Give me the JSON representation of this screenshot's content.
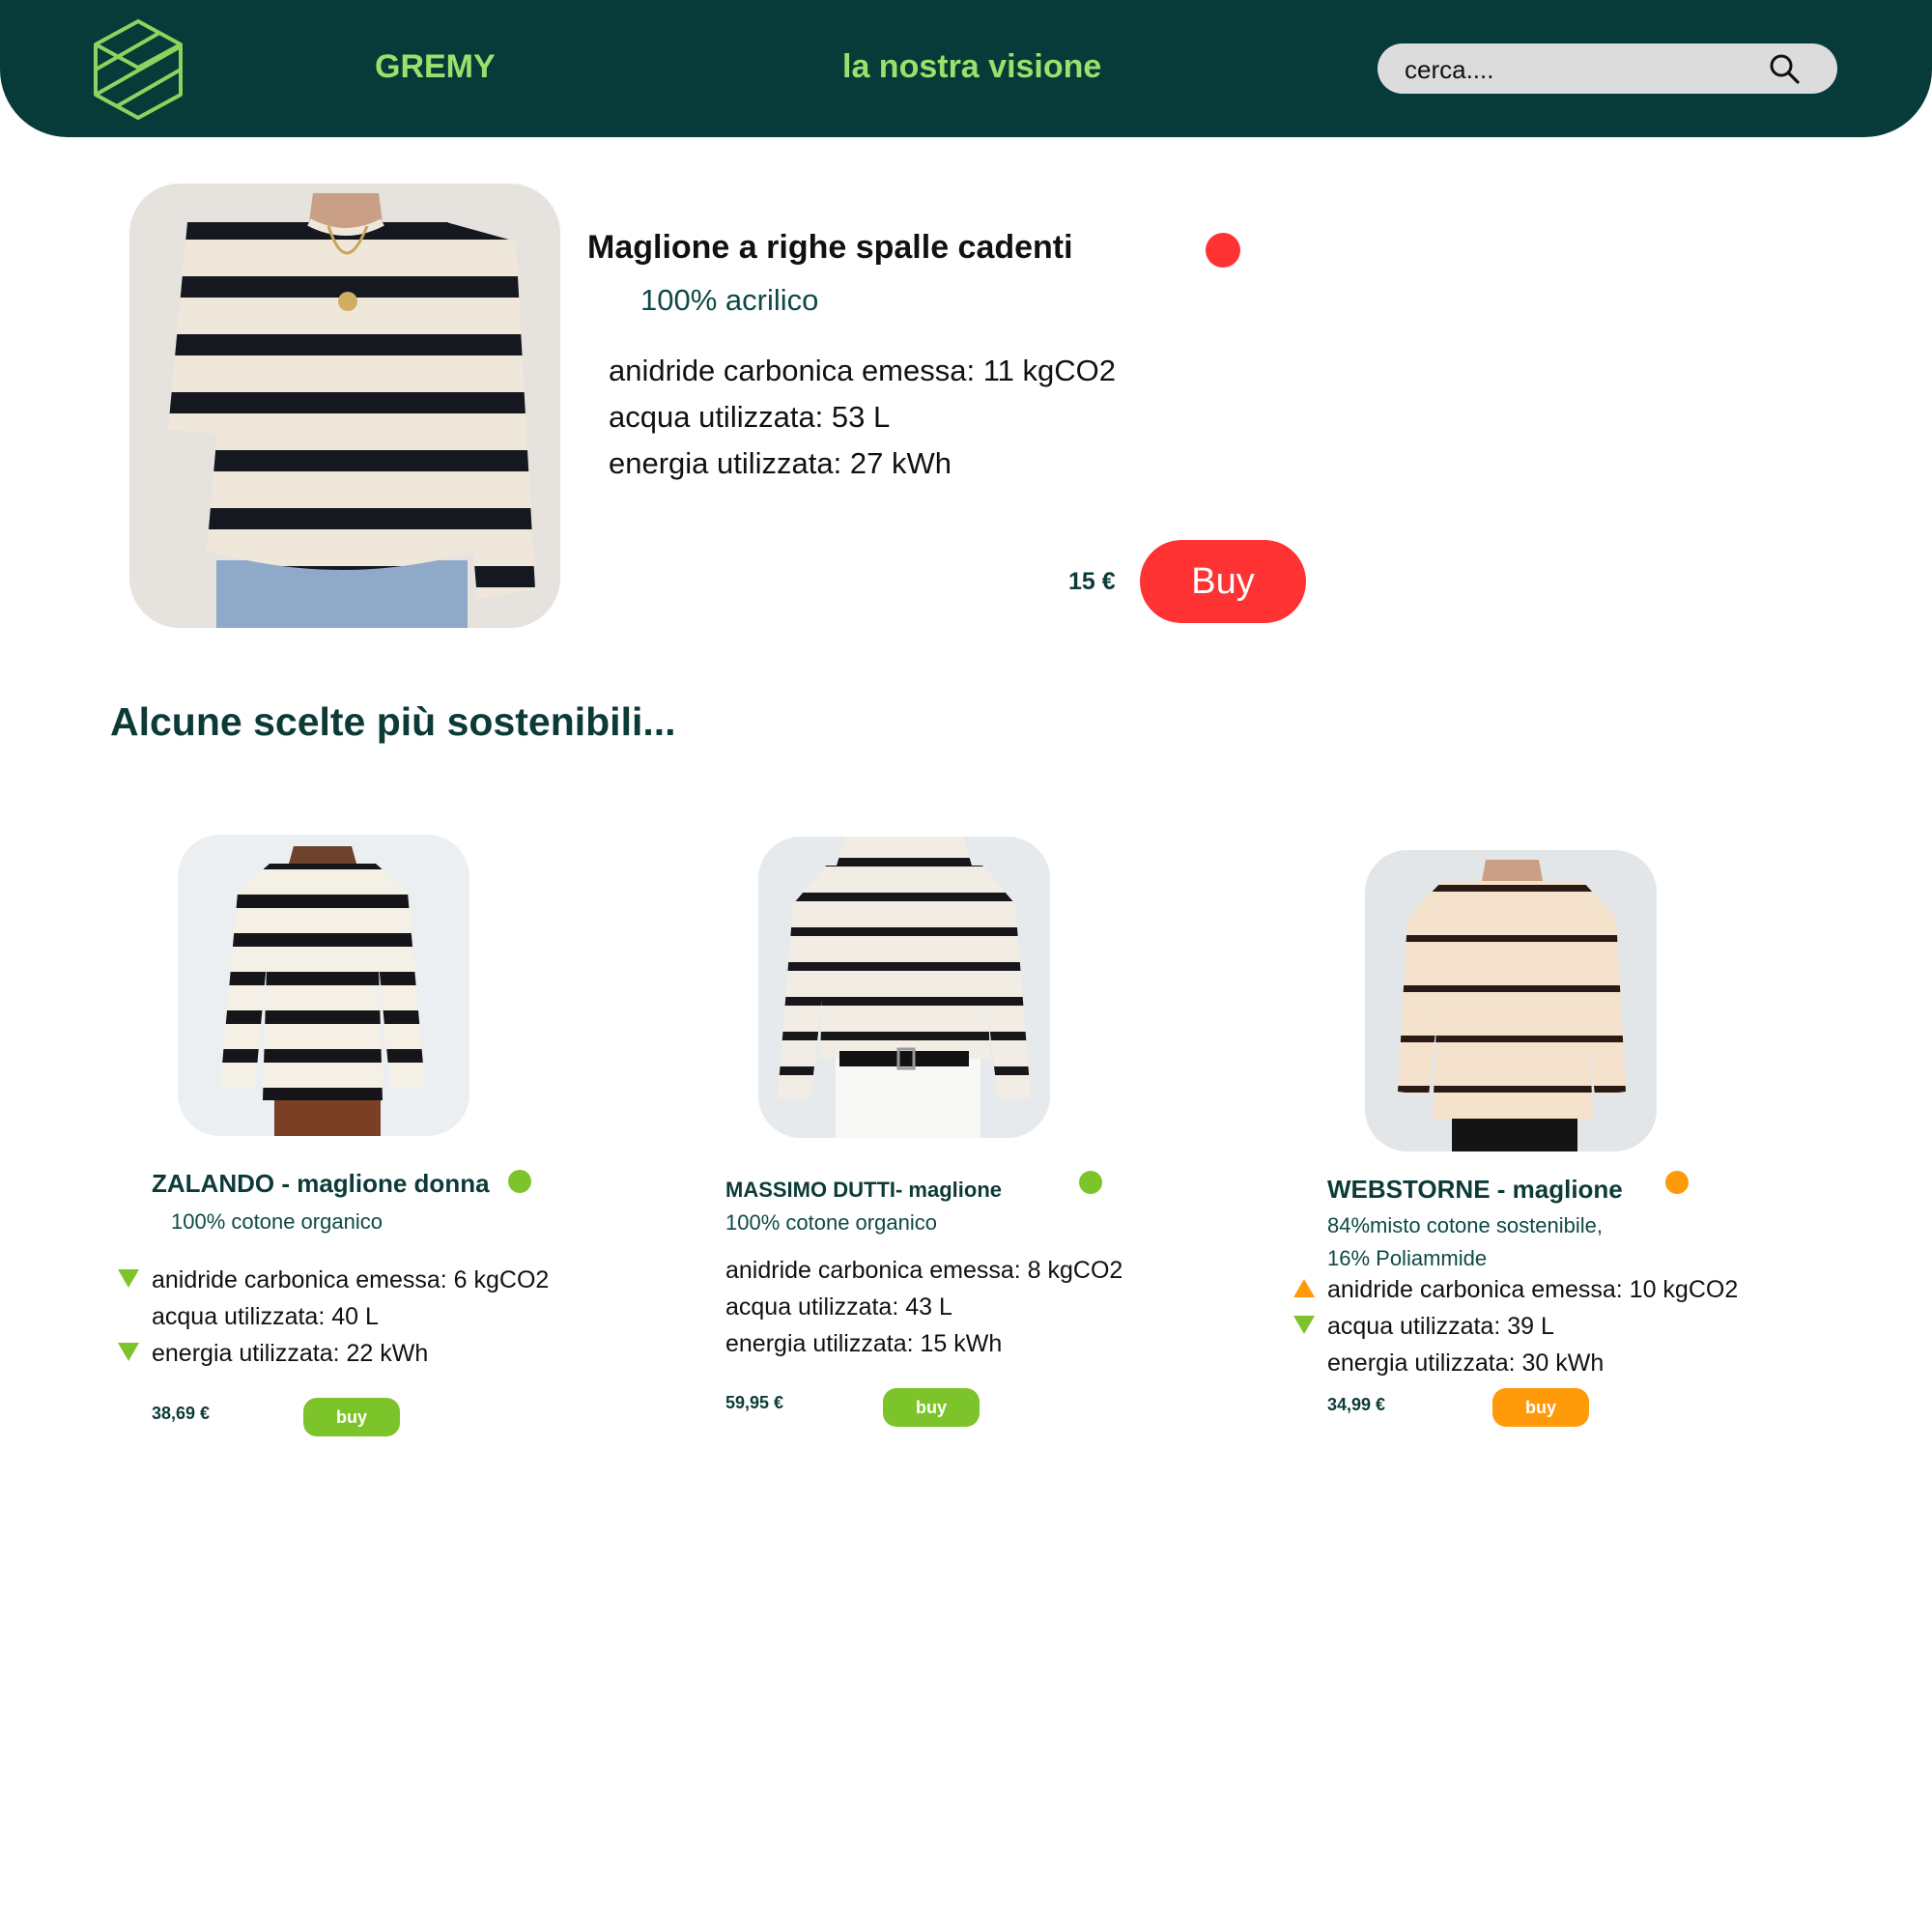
{
  "header": {
    "brand": "GREMY",
    "vision_link": "la nostra visione",
    "search_placeholder": "cerca....",
    "bg_color": "#073b3a",
    "accent_color": "#9be06a"
  },
  "featured": {
    "title": "Maglione a righe spalle cadenti",
    "material": "100% acrilico",
    "status_color": "#ff3333",
    "stats": [
      "anidride carbonica emessa: 11 kgCO2",
      "acqua utilizzata: 53 L",
      "energia utilizzata: 27 kWh"
    ],
    "price": "15 €",
    "buy_label": "Buy"
  },
  "section": {
    "title": "Alcune scelte più sostenibili..."
  },
  "alternatives": [
    {
      "name": "ZALANDO - maglione donna",
      "material_lines": [
        "100% cotone organico"
      ],
      "status_color": "#7dc42b",
      "stats": [
        {
          "text": "anidride carbonica emessa: 6 kgCO2",
          "trend": "down"
        },
        {
          "text": "acqua utilizzata: 40 L",
          "trend": "none"
        },
        {
          "text": "energia utilizzata: 22 kWh",
          "trend": "down"
        }
      ],
      "price": "38,69 €",
      "buy_label": "buy",
      "buy_color": "#7dc42b"
    },
    {
      "name": "MASSIMO DUTTI- maglione",
      "material_lines": [
        "100% cotone organico"
      ],
      "status_color": "#7dc42b",
      "stats": [
        {
          "text": "anidride carbonica emessa: 8 kgCO2",
          "trend": "none"
        },
        {
          "text": "acqua utilizzata: 43 L",
          "trend": "none"
        },
        {
          "text": "energia utilizzata: 15 kWh",
          "trend": "none"
        }
      ],
      "price": "59,95 €",
      "buy_label": "buy",
      "buy_color": "#7dc42b"
    },
    {
      "name": "WEBSTORNE - maglione",
      "material_lines": [
        "84%misto cotone sostenibile,",
        "16% Poliammide"
      ],
      "status_color": "#ff9a0a",
      "stats": [
        {
          "text": "anidride carbonica emessa: 10 kgCO2",
          "trend": "up"
        },
        {
          "text": "acqua utilizzata: 39 L",
          "trend": "down"
        },
        {
          "text": "energia utilizzata: 30 kWh",
          "trend": "none"
        }
      ],
      "price": "34,99 €",
      "buy_label": "buy",
      "buy_color": "#ff9a0a"
    }
  ]
}
